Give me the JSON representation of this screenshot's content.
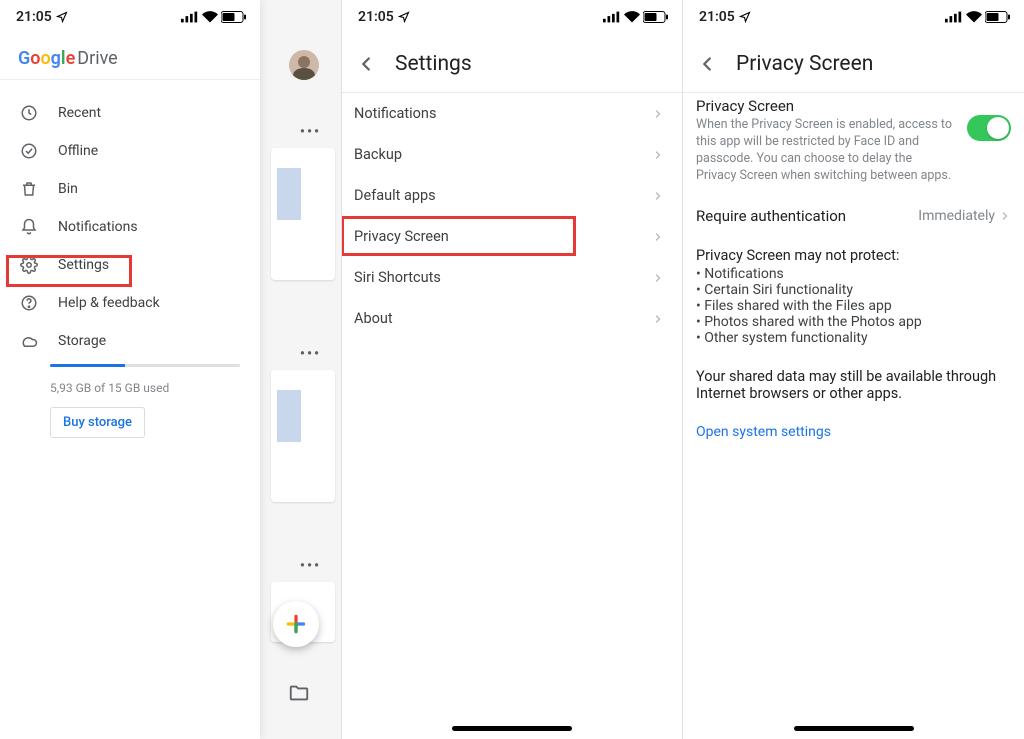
{
  "status": {
    "time": "21:05"
  },
  "panelA": {
    "app_name": "Drive",
    "items": {
      "recent": "Recent",
      "offline": "Offline",
      "bin": "Bin",
      "notifications": "Notifications",
      "settings": "Settings",
      "help": "Help & feedback",
      "storage": "Storage"
    },
    "storage_used_label": "5,93 GB of 15 GB used",
    "storage_percent": 39.5,
    "buy_label": "Buy storage"
  },
  "panelB": {
    "title": "Settings",
    "rows": {
      "notifications": "Notifications",
      "backup": "Backup",
      "default_apps": "Default apps",
      "privacy_screen": "Privacy Screen",
      "siri": "Siri Shortcuts",
      "about": "About"
    }
  },
  "panelC": {
    "title": "Privacy Screen",
    "section_title": "Privacy Screen",
    "section_desc": "When the Privacy Screen is enabled, access to this app will be restricted by Face ID and passcode. You can choose to delay the Privacy Screen when switching between apps.",
    "toggle_on": true,
    "require_label": "Require authentication",
    "require_value": "Immediately",
    "warning_title": "Privacy Screen may not protect:",
    "bullets": [
      "Notifications",
      "Certain Siri functionality",
      "Files shared with the Files app",
      "Photos shared with the Photos app",
      "Other system functionality"
    ],
    "note": "Your shared data may still be available through Internet browsers or other apps.",
    "link": "Open system settings"
  }
}
